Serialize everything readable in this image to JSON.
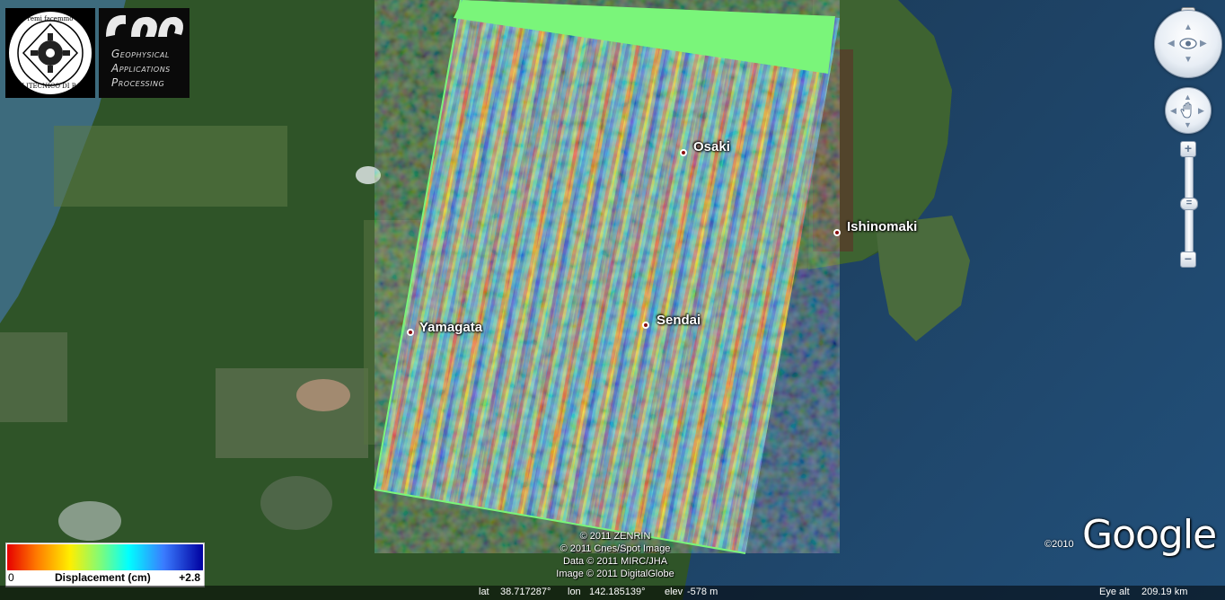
{
  "logos": {
    "polytechnic_motto": "de remi facemmo ali",
    "polytechnic_name": "POLITECNICO DI BARI",
    "gap_lines": [
      "Geophysical",
      "Applications",
      "Processing"
    ]
  },
  "places": [
    {
      "name": "Osaki"
    },
    {
      "name": "Ishinomaki"
    },
    {
      "name": "Yamagata"
    },
    {
      "name": "Sendai"
    }
  ],
  "legend": {
    "min": "0",
    "label": "Displacement (cm)",
    "max": "+2.8"
  },
  "copyright": [
    "© 2011 ZENRIN",
    "© 2011 Cnes/Spot Image",
    "Data © 2011 MIRC/JHA",
    "Image © 2011 DigitalGlobe"
  ],
  "status": {
    "lat_label": "lat",
    "lat_value": "38.717287°",
    "lon_label": "lon",
    "lon_value": "142.185139°",
    "elev_label": "elev",
    "elev_value": "-578 m",
    "eye_alt_label": "Eye alt",
    "eye_alt_value": "209.19 km"
  },
  "branding": {
    "google": "Google",
    "year": "©2010"
  },
  "navigation": {
    "north": "N",
    "zoom_in": "+",
    "zoom_out": "−"
  },
  "icons": {
    "look": "eye-icon",
    "move": "hand-icon"
  }
}
